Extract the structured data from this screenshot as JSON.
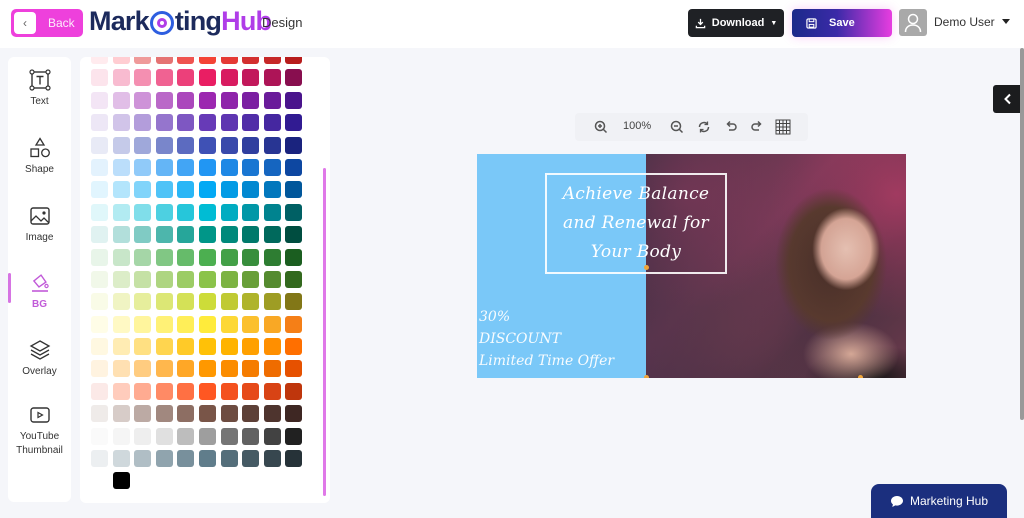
{
  "header": {
    "back_label": "Back",
    "logo": {
      "part1": "Mark",
      "part2": "ting",
      "part3": "Hub"
    },
    "page_label": "Design",
    "download_label": "Download",
    "save_label": "Save",
    "user_name": "Demo User"
  },
  "sidebar": {
    "items": [
      {
        "label": "Text",
        "icon": "text-box-icon"
      },
      {
        "label": "Shape",
        "icon": "shapes-icon"
      },
      {
        "label": "Image",
        "icon": "image-icon"
      },
      {
        "label": "BG",
        "icon": "paint-bucket-icon",
        "active": true
      },
      {
        "label": "Overlay",
        "icon": "layers-icon"
      },
      {
        "label": "YouTube Thumbnail",
        "icon": "youtube-icon"
      }
    ]
  },
  "palette": {
    "rows": [
      [
        "#ffebee",
        "#ffcdd2",
        "#ef9a9a",
        "#e57373",
        "#ef5350",
        "#f44336",
        "#e53935",
        "#d32f2f",
        "#c62828",
        "#b71c1c"
      ],
      [
        "#fce4ec",
        "#f8bbd0",
        "#f48fb1",
        "#f06292",
        "#ec407a",
        "#e91e63",
        "#d81b60",
        "#c2185b",
        "#ad1457",
        "#880e4f"
      ],
      [
        "#f3e5f5",
        "#e1bee7",
        "#ce93d8",
        "#ba68c8",
        "#ab47bc",
        "#9c27b0",
        "#8e24aa",
        "#7b1fa2",
        "#6a1b9a",
        "#4a148c"
      ],
      [
        "#ede7f6",
        "#d1c4e9",
        "#b39ddb",
        "#9575cd",
        "#7e57c2",
        "#673ab7",
        "#5e35b1",
        "#512da8",
        "#4527a0",
        "#311b92"
      ],
      [
        "#e8eaf6",
        "#c5cae9",
        "#9fa8da",
        "#7986cb",
        "#5c6bc0",
        "#3f51b5",
        "#3949ab",
        "#303f9f",
        "#283593",
        "#1a237e"
      ],
      [
        "#e3f2fd",
        "#bbdefb",
        "#90caf9",
        "#64b5f6",
        "#42a5f5",
        "#2196f3",
        "#1e88e5",
        "#1976d2",
        "#1565c0",
        "#0d47a1"
      ],
      [
        "#e1f5fe",
        "#b3e5fc",
        "#81d4fa",
        "#4fc3f7",
        "#29b6f6",
        "#03a9f4",
        "#039be5",
        "#0288d1",
        "#0277bd",
        "#01579b"
      ],
      [
        "#e0f7fa",
        "#b2ebf2",
        "#80deea",
        "#4dd0e1",
        "#26c6da",
        "#00bcd4",
        "#00acc1",
        "#0097a7",
        "#00838f",
        "#006064"
      ],
      [
        "#e0f2f1",
        "#b2dfdb",
        "#80cbc4",
        "#4db6ac",
        "#26a69a",
        "#009688",
        "#00897b",
        "#00796b",
        "#00695c",
        "#004d40"
      ],
      [
        "#e8f5e9",
        "#c8e6c9",
        "#a5d6a7",
        "#81c784",
        "#66bb6a",
        "#4caf50",
        "#43a047",
        "#388e3c",
        "#2e7d32",
        "#1b5e20"
      ],
      [
        "#f1f8e9",
        "#dcedc8",
        "#c5e1a5",
        "#aed581",
        "#9ccc65",
        "#8bc34a",
        "#7cb342",
        "#689f38",
        "#558b2f",
        "#33691e"
      ],
      [
        "#f9fbe7",
        "#f0f4c3",
        "#e6ee9c",
        "#dce775",
        "#d4e157",
        "#cddc39",
        "#c0ca33",
        "#afb42b",
        "#9e9d24",
        "#827717"
      ],
      [
        "#fffde7",
        "#fff9c4",
        "#fff59d",
        "#fff176",
        "#ffee58",
        "#ffeb3b",
        "#fdd835",
        "#fbc02d",
        "#f9a825",
        "#f57f17"
      ],
      [
        "#fff8e1",
        "#ffecb3",
        "#ffe082",
        "#ffd54f",
        "#ffca28",
        "#ffc107",
        "#ffb300",
        "#ffa000",
        "#ff8f00",
        "#ff6f00"
      ],
      [
        "#fff3e0",
        "#ffe0b2",
        "#ffcc80",
        "#ffb74d",
        "#ffa726",
        "#ff9800",
        "#fb8c00",
        "#f57c00",
        "#ef6c00",
        "#e65100"
      ],
      [
        "#fbe9e7",
        "#ffccbc",
        "#ffab91",
        "#ff8a65",
        "#ff7043",
        "#ff5722",
        "#f4511e",
        "#e64a19",
        "#d84315",
        "#bf360c"
      ],
      [
        "#efebe9",
        "#d7ccc8",
        "#bcaaa4",
        "#a1887f",
        "#8d6e63",
        "#795548",
        "#6d4c41",
        "#5d4037",
        "#4e342e",
        "#3e2723"
      ],
      [
        "#fafafa",
        "#f5f5f5",
        "#eeeeee",
        "#e0e0e0",
        "#bdbdbd",
        "#9e9e9e",
        "#757575",
        "#616161",
        "#424242",
        "#212121"
      ],
      [
        "#eceff1",
        "#cfd8dc",
        "#b0bec5",
        "#90a4ae",
        "#78909c",
        "#607d8b",
        "#546e7a",
        "#455a64",
        "#37474f",
        "#263238"
      ],
      [
        "#ffffff",
        "#000000"
      ]
    ]
  },
  "canvas": {
    "zoom_level": "100%",
    "headline": [
      "Achieve Balance",
      "and Renewal for",
      "Your Body"
    ],
    "promo": [
      "30%",
      "DISCOUNT",
      "Limited Time Offer"
    ],
    "left_bg_color": "#7ac8f8"
  },
  "chat": {
    "label": "Marketing Hub"
  }
}
